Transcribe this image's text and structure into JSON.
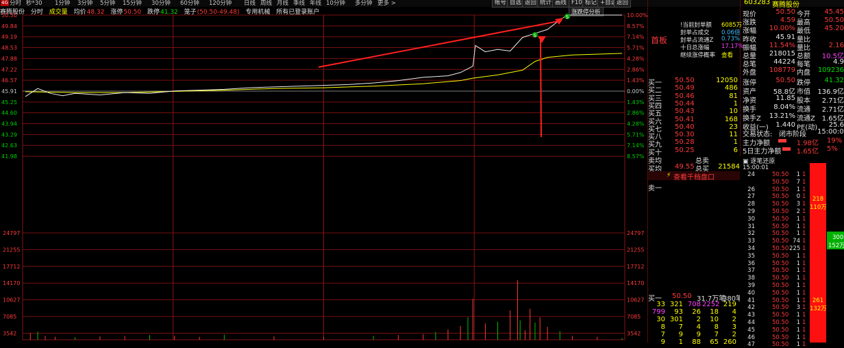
{
  "toolbar": {
    "left_buttons": [
      "分时",
      "秒*30",
      "1分钟",
      "3分钟",
      "5分钟",
      "15分钟",
      "30分钟",
      "60分钟",
      "120分钟",
      "日线",
      "周线",
      "月线",
      "季线",
      "年线",
      "10分钟",
      "多分钟",
      "更多 >"
    ],
    "right_buttons": [
      "帐号",
      "自选",
      "返回",
      "统计",
      "画线",
      "F10",
      "标记",
      "+自选",
      "返回"
    ],
    "badge": "4G"
  },
  "chart_header": {
    "stock_name": "赛腾股份",
    "mode": "分时",
    "volume_label": "成交量",
    "avg_label": "均价",
    "avg_value": "48.32",
    "limit_up_label": "涨停",
    "limit_up_value": "50.50",
    "limit_down_label": "跌停",
    "limit_down_value": "41.32",
    "cursor_label": "笼子",
    "cursor_value": "(50.50-49.48)",
    "account_label": "专用机械",
    "account_status": "所有已登录账户",
    "analysis_button": "涨跌停分析"
  },
  "chart_data": {
    "type": "line",
    "title": "",
    "price_axis_left": [
      "50.50",
      "49.84",
      "49.19",
      "48.53",
      "47.88",
      "47.22",
      "46.57",
      "45.91",
      "45.25",
      "44.60",
      "43.94",
      "43.29",
      "42.63",
      "41.98"
    ],
    "pct_axis_right": [
      "10.00%",
      "8.57%",
      "7.14%",
      "5.71%",
      "4.28%",
      "2.86%",
      "1.43%",
      "0.00%",
      "1.43%",
      "2.86%",
      "4.28%",
      "5.71%",
      "7.14%",
      "8.57%"
    ],
    "volume_axis_left": [
      "24797",
      "21255",
      "17712",
      "14170",
      "10627",
      "7085",
      "3542"
    ],
    "volume_axis_right": [
      "24797",
      "21255",
      "17712",
      "14170",
      "10627",
      "7085",
      "3542"
    ],
    "prev_close": 45.91,
    "ylim": [
      41.32,
      50.5
    ],
    "volume_max": 24797,
    "price_series": [
      [
        0,
        45.4
      ],
      [
        5,
        45.9
      ],
      [
        10,
        45.6
      ],
      [
        15,
        45.45
      ],
      [
        20,
        45.6
      ],
      [
        30,
        45.5
      ],
      [
        40,
        45.65
      ],
      [
        50,
        45.6
      ],
      [
        60,
        45.75
      ],
      [
        70,
        45.8
      ],
      [
        80,
        45.85
      ],
      [
        90,
        45.95
      ],
      [
        100,
        46.0
      ],
      [
        110,
        46.05
      ],
      [
        120,
        46.1
      ],
      [
        130,
        46.15
      ],
      [
        140,
        46.25
      ],
      [
        150,
        46.4
      ],
      [
        160,
        46.6
      ],
      [
        165,
        46.65
      ],
      [
        170,
        46.7
      ],
      [
        175,
        46.9
      ],
      [
        180,
        47.3
      ],
      [
        181,
        48.6
      ],
      [
        185,
        48.2
      ],
      [
        190,
        48.35
      ],
      [
        195,
        48.25
      ],
      [
        200,
        49.1
      ],
      [
        205,
        49.35
      ],
      [
        210,
        49.6
      ],
      [
        215,
        50.2
      ],
      [
        218,
        50.5
      ],
      [
        240,
        50.5
      ]
    ],
    "avg_series": [
      [
        0,
        45.7
      ],
      [
        20,
        45.65
      ],
      [
        40,
        45.65
      ],
      [
        60,
        45.72
      ],
      [
        80,
        45.8
      ],
      [
        100,
        45.9
      ],
      [
        120,
        45.95
      ],
      [
        140,
        46.05
      ],
      [
        160,
        46.2
      ],
      [
        175,
        46.4
      ],
      [
        180,
        46.55
      ],
      [
        190,
        46.75
      ],
      [
        200,
        47.05
      ],
      [
        205,
        47.6
      ],
      [
        210,
        47.85
      ],
      [
        220,
        48.0
      ],
      [
        240,
        48.1
      ]
    ],
    "volume_series": [
      [
        2,
        1600
      ],
      [
        5,
        1900
      ],
      [
        8,
        900
      ],
      [
        12,
        700
      ],
      [
        20,
        600
      ],
      [
        30,
        800
      ],
      [
        40,
        900
      ],
      [
        50,
        1100
      ],
      [
        60,
        900
      ],
      [
        70,
        700
      ],
      [
        80,
        1200
      ],
      [
        100,
        800
      ],
      [
        120,
        700
      ],
      [
        140,
        900
      ],
      [
        150,
        1100
      ],
      [
        160,
        1300
      ],
      [
        165,
        1800
      ],
      [
        170,
        2400
      ],
      [
        175,
        3200
      ],
      [
        178,
        5200
      ],
      [
        180,
        9500
      ],
      [
        185,
        3800
      ],
      [
        190,
        4200
      ],
      [
        195,
        6800
      ],
      [
        198,
        13800
      ],
      [
        199,
        4500
      ],
      [
        201,
        2200
      ],
      [
        203,
        7200
      ],
      [
        205,
        4000
      ],
      [
        207,
        5200
      ],
      [
        210,
        3000
      ],
      [
        215,
        2000
      ],
      [
        220,
        900
      ],
      [
        230,
        700
      ],
      [
        240,
        400
      ]
    ]
  },
  "arrow_labels": [
    "S",
    "S"
  ],
  "quote": {
    "code": "603283",
    "name": "赛腾股份",
    "section_title": "首板",
    "seal_amount_label": "!当前封单额",
    "seal_amount_value": "6085万",
    "seal_ratio_label": "封单占成交",
    "seal_ratio_value": "0.06倍",
    "seal_float_label": "封单占流通Z",
    "seal_float_value": "0.73%",
    "ten_day_label": "十日总涨幅",
    "ten_day_value": "17.17%",
    "continue_label": "继续涨停概率",
    "continue_link": "查看",
    "rows": [
      {
        "k1": "现价",
        "v1": "50.50",
        "k2": "今开",
        "v2": "45.45"
      },
      {
        "k1": "涨跌",
        "v1": "4.59",
        "k2": "最高",
        "v2": "50.50"
      },
      {
        "k1": "涨幅",
        "v1": "10.00%",
        "k2": "最低",
        "v2": "45.20"
      },
      {
        "k1": "昨收",
        "v1": "45.91",
        "k2": "量比",
        "v2": ""
      },
      {
        "k1": "振幅",
        "v1": "11.54%",
        "k2": "量比",
        "v2": "2.16"
      },
      {
        "k1": "总量",
        "v1": "218015",
        "k2": "总额",
        "v2": "10.5亿"
      },
      {
        "k1": "总笔",
        "v1": "44224",
        "k2": "每笔",
        "v2": "4.9"
      },
      {
        "k1": "外盘",
        "v1": "108779",
        "k2": "内盘",
        "v2": "109236"
      }
    ],
    "buy_levels": [
      {
        "label": "买一",
        "price": "50.50",
        "vol": "12050"
      },
      {
        "label": "买二",
        "price": "50.49",
        "vol": "486"
      },
      {
        "label": "买三",
        "price": "50.46",
        "vol": "81"
      },
      {
        "label": "买四",
        "price": "50.44",
        "vol": "1"
      },
      {
        "label": "买五",
        "price": "50.43",
        "vol": "10"
      },
      {
        "label": "买六",
        "price": "50.41",
        "vol": "168"
      },
      {
        "label": "买七",
        "price": "50.40",
        "vol": "23"
      },
      {
        "label": "买八",
        "price": "50.30",
        "vol": "11"
      },
      {
        "label": "买九",
        "price": "50.28",
        "vol": "1"
      },
      {
        "label": "买十",
        "price": "50.25",
        "vol": "6"
      }
    ],
    "sell_avg_label": "卖均",
    "sell_total_label": "总卖",
    "buy_avg_label": "买均",
    "buy_avg_value": "49.55",
    "buy_total_label": "总买",
    "buy_total_value": "21584",
    "depth_link": "查看千档盘口",
    "sell_one": "卖一",
    "stats": [
      {
        "k1": "涨停",
        "v1": "50.50",
        "k2": "跌停",
        "v2": "41.32"
      },
      {
        "k1": "资产",
        "v1": "58.8亿",
        "k2": "市值",
        "v2": "136.9亿"
      },
      {
        "k1": "净资",
        "v1": "11.85",
        "k2": "股本",
        "v2": "2.71亿"
      },
      {
        "k1": "换手",
        "v1": "8.04%",
        "k2": "流通",
        "v2": "2.71亿"
      },
      {
        "k1": "换手Z",
        "v1": "13.21%",
        "k2": "流通Z",
        "v2": "1.65亿"
      },
      {
        "k1": "收益(一)",
        "v1": "1.440",
        "k2": "PE(动)",
        "v2": "25.6"
      }
    ],
    "trade_status_label": "交易状态:",
    "trade_status": "闭市阶段",
    "trade_time": "15:00:04",
    "main_net_label": "主力净额",
    "main_net_value": "1.98亿",
    "main_net_pct": "19%",
    "five_day_label": "5日主力净额",
    "five_day_value": "1.65亿",
    "five_day_pct": "5%",
    "buy_one_summary": {
      "label": "买一",
      "price": "50.50",
      "orders": "31.7万笔",
      "count": "380笔"
    },
    "queue_rows": [
      [
        "33",
        "321",
        "708",
        "2252",
        "219"
      ],
      [
        "799",
        "93",
        "26",
        "18",
        "4"
      ],
      [
        "30",
        "301",
        "2",
        "10",
        "2"
      ],
      [
        "8",
        "7",
        "4",
        "8",
        "3"
      ],
      [
        "7",
        "9",
        "9",
        "7",
        "2"
      ],
      [
        "9",
        "1",
        "88",
        "65",
        "260"
      ]
    ]
  },
  "tick_panel": {
    "title": "逐笔还原",
    "first_time": "15:00:01",
    "rows": [
      {
        "t": "24",
        "p": "50.50",
        "v": "1"
      },
      {
        "t": "",
        "p": "50.50",
        "v": "7"
      },
      {
        "t": "26",
        "p": "50.50",
        "v": "1"
      },
      {
        "t": "27",
        "p": "50.50",
        "v": "0"
      },
      {
        "t": "28",
        "p": "50.50",
        "v": "3"
      },
      {
        "t": "29",
        "p": "50.50",
        "v": "2"
      },
      {
        "t": "30",
        "p": "50.50",
        "v": "1"
      },
      {
        "t": "31",
        "p": "50.50",
        "v": "1"
      },
      {
        "t": "32",
        "p": "50.50",
        "v": "1"
      },
      {
        "t": "33",
        "p": "50.50",
        "v": "74"
      },
      {
        "t": "34",
        "p": "50.50",
        "v": "225"
      },
      {
        "t": "35",
        "p": "50.50",
        "v": "1"
      },
      {
        "t": "36",
        "p": "50.50",
        "v": "1"
      },
      {
        "t": "37",
        "p": "50.50",
        "v": "1"
      },
      {
        "t": "38",
        "p": "50.50",
        "v": "1"
      },
      {
        "t": "39",
        "p": "50.50",
        "v": "1"
      },
      {
        "t": "40",
        "p": "50.50",
        "v": "1"
      },
      {
        "t": "41",
        "p": "50.50",
        "v": "1"
      },
      {
        "t": "42",
        "p": "50.50",
        "v": "3"
      },
      {
        "t": "43",
        "p": "50.50",
        "v": "1"
      },
      {
        "t": "44",
        "p": "50.50",
        "v": "1"
      },
      {
        "t": "45",
        "p": "50.50",
        "v": "1"
      },
      {
        "t": "46",
        "p": "50.50",
        "v": "1"
      },
      {
        "t": "47",
        "p": "50.50",
        "v": "1"
      }
    ],
    "bar_label_1": "218\n110万",
    "bar_label_2": "261\n132万",
    "green_label": "300\n152万"
  },
  "colors": {
    "red": "#ff3b3b",
    "green": "#00e000",
    "yellow": "#ffff00",
    "grid": "#7a1010"
  }
}
